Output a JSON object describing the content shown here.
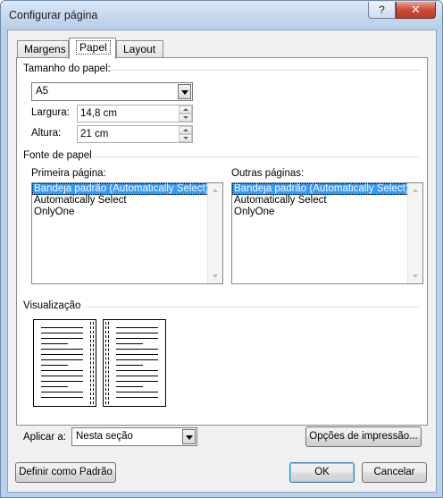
{
  "window": {
    "title": "Configurar página",
    "help_label": "?",
    "close_label": "✕"
  },
  "tabs": [
    {
      "label": "Margens",
      "active": false
    },
    {
      "label": "Papel",
      "active": true
    },
    {
      "label": "Layout",
      "active": false
    }
  ],
  "paper_size": {
    "group_title": "Tamanho do papel:",
    "selected": "A5",
    "width_label": "Largura:",
    "width_value": "14,8 cm",
    "height_label": "Altura:",
    "height_value": "21 cm"
  },
  "paper_source": {
    "group_title": "Fonte de papel",
    "first_page_label": "Primeira página:",
    "other_pages_label": "Outras páginas:",
    "first_page_items": [
      {
        "label": "Bandeja padrão (Automatically Select)",
        "selected": true
      },
      {
        "label": "Automatically Select",
        "selected": false
      },
      {
        "label": "OnlyOne",
        "selected": false
      }
    ],
    "other_pages_items": [
      {
        "label": "Bandeja padrão (Automatically Select)",
        "selected": true
      },
      {
        "label": "Automatically Select",
        "selected": false
      },
      {
        "label": "OnlyOne",
        "selected": false
      }
    ]
  },
  "preview": {
    "title": "Visualização"
  },
  "apply_to": {
    "label": "Aplicar a:",
    "selected": "Nesta seção"
  },
  "buttons": {
    "print_options": "Opções de impressão...",
    "set_default": "Definir como Padrão",
    "ok": "OK",
    "cancel": "Cancelar"
  },
  "colors": {
    "selection": "#3399ff",
    "frame": "#b9d1ea",
    "close_button": "#c0392b"
  }
}
